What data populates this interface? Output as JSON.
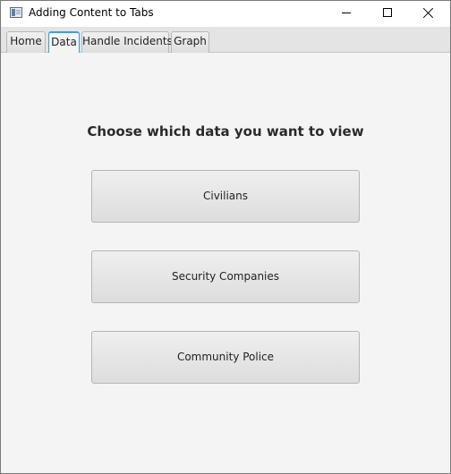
{
  "window": {
    "title": "Adding Content to Tabs",
    "icon": "app-window-icon",
    "controls": {
      "minimize_icon": "minimize-icon",
      "maximize_icon": "maximize-icon",
      "close_icon": "close-icon"
    }
  },
  "tabs": [
    {
      "label": "Home",
      "selected": false
    },
    {
      "label": "Data",
      "selected": true
    },
    {
      "label": "Handle Incidents",
      "selected": false
    },
    {
      "label": "Graph",
      "selected": false
    }
  ],
  "main": {
    "heading": "Choose which data you want to view",
    "buttons": [
      {
        "label": "Civilians"
      },
      {
        "label": "Security Companies"
      },
      {
        "label": "Community Police"
      }
    ]
  },
  "colors": {
    "accent": "#39a0e0",
    "background": "#f4f4f4"
  }
}
